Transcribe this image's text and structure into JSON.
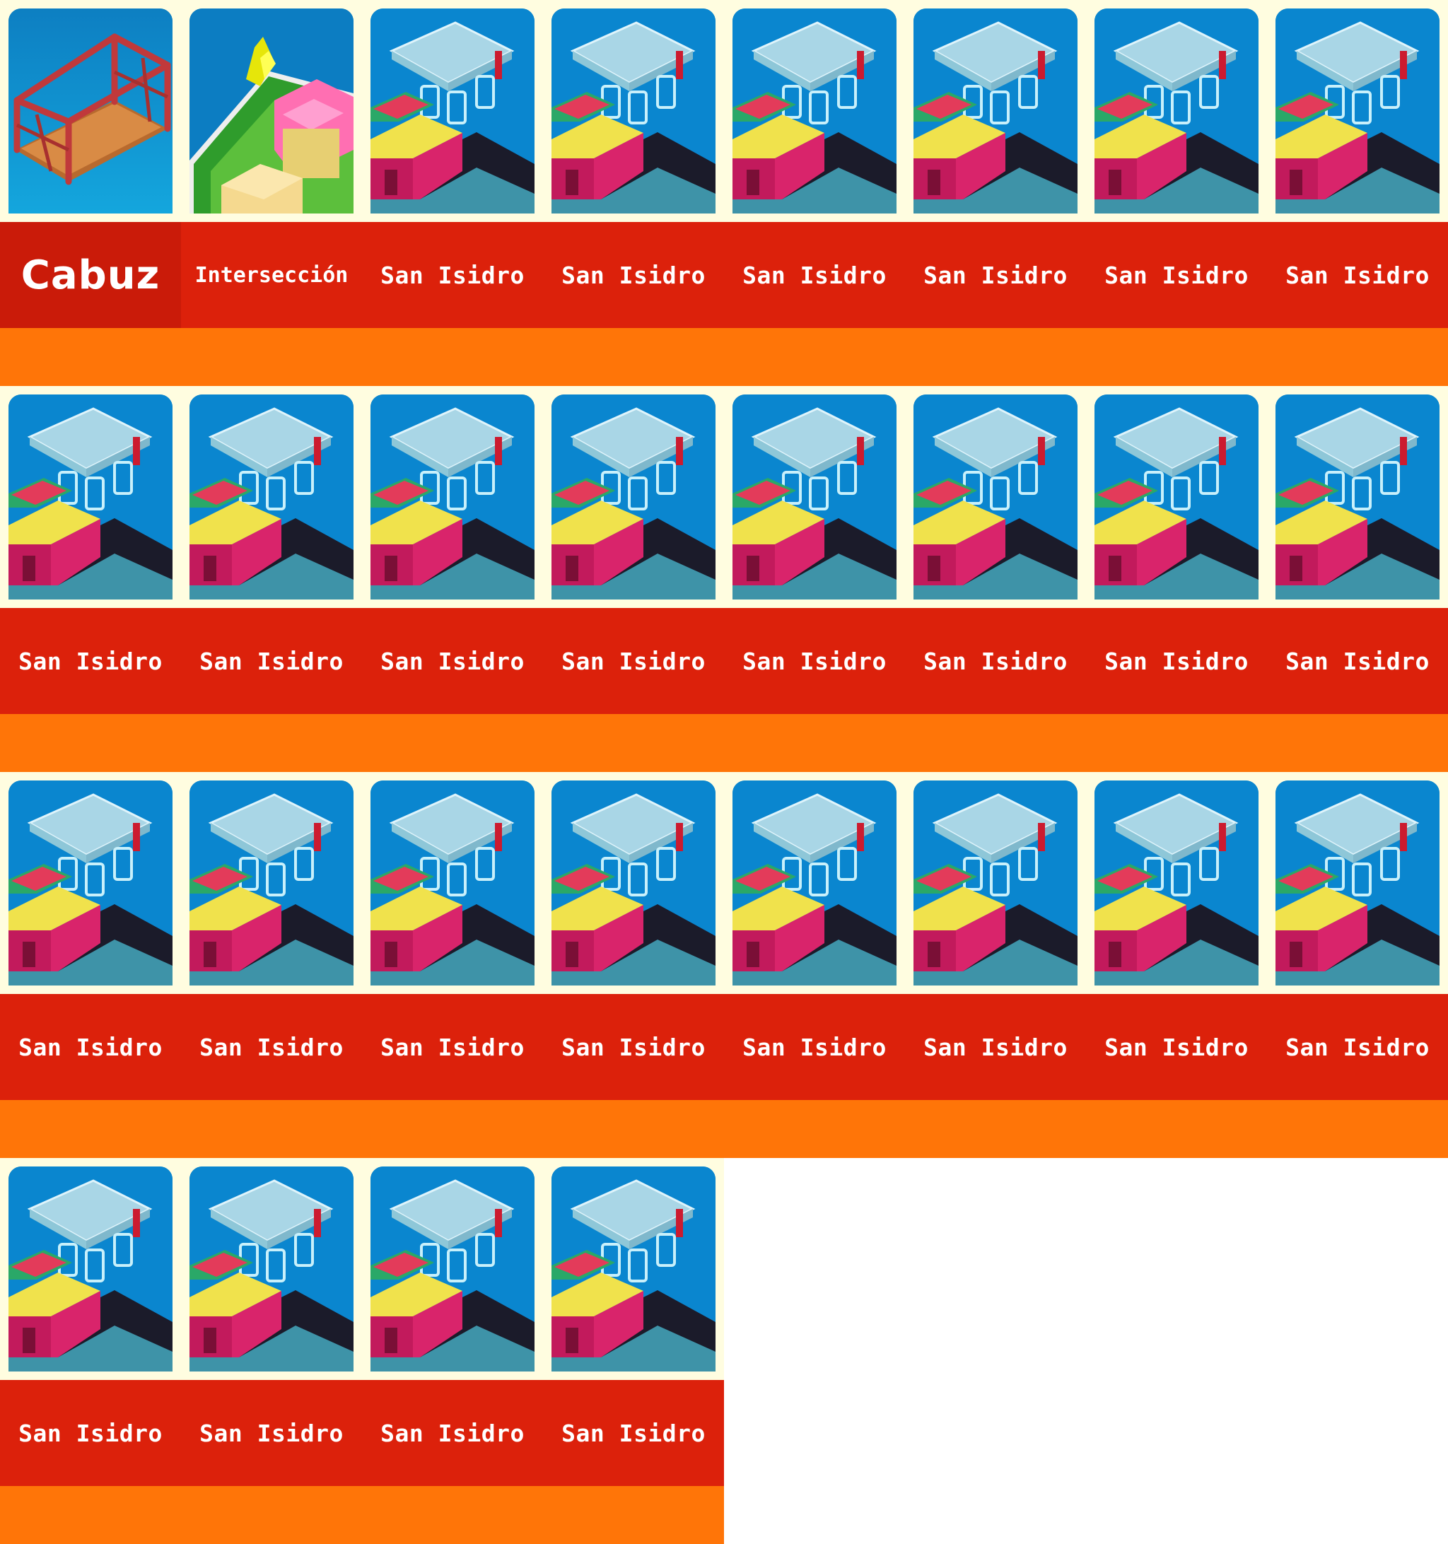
{
  "items": [
    {
      "name": "Cabuz",
      "icon": "bridge-icon",
      "selected": true
    },
    {
      "name": "Intersección",
      "icon": "intersection-icon"
    },
    {
      "name": "San Isidro",
      "icon": "gas-station-icon"
    },
    {
      "name": "San Isidro",
      "icon": "gas-station-icon"
    },
    {
      "name": "San Isidro",
      "icon": "gas-station-icon"
    },
    {
      "name": "San Isidro",
      "icon": "gas-station-icon"
    },
    {
      "name": "San Isidro",
      "icon": "gas-station-icon"
    },
    {
      "name": "San Isidro",
      "icon": "gas-station-icon"
    },
    {
      "name": "San Isidro",
      "icon": "gas-station-icon"
    },
    {
      "name": "San Isidro",
      "icon": "gas-station-icon"
    },
    {
      "name": "San Isidro",
      "icon": "gas-station-icon"
    },
    {
      "name": "San Isidro",
      "icon": "gas-station-icon"
    },
    {
      "name": "San Isidro",
      "icon": "gas-station-icon"
    },
    {
      "name": "San Isidro",
      "icon": "gas-station-icon"
    },
    {
      "name": "San Isidro",
      "icon": "gas-station-icon"
    },
    {
      "name": "San Isidro",
      "icon": "gas-station-icon"
    },
    {
      "name": "San Isidro",
      "icon": "gas-station-icon"
    },
    {
      "name": "San Isidro",
      "icon": "gas-station-icon"
    },
    {
      "name": "San Isidro",
      "icon": "gas-station-icon"
    },
    {
      "name": "San Isidro",
      "icon": "gas-station-icon"
    },
    {
      "name": "San Isidro",
      "icon": "gas-station-icon"
    },
    {
      "name": "San Isidro",
      "icon": "gas-station-icon"
    },
    {
      "name": "San Isidro",
      "icon": "gas-station-icon"
    },
    {
      "name": "San Isidro",
      "icon": "gas-station-icon"
    },
    {
      "name": "San Isidro",
      "icon": "gas-station-icon"
    },
    {
      "name": "San Isidro",
      "icon": "gas-station-icon"
    },
    {
      "name": "San Isidro",
      "icon": "gas-station-icon"
    },
    {
      "name": "San Isidro",
      "icon": "gas-station-icon"
    }
  ],
  "colors": {
    "card_bg": "#fffde0",
    "name_bar": "#dc210b",
    "footer_bar": "#ff7508",
    "sky_top": "#0c6fb6",
    "sky_bottom": "#0aa3e0"
  }
}
